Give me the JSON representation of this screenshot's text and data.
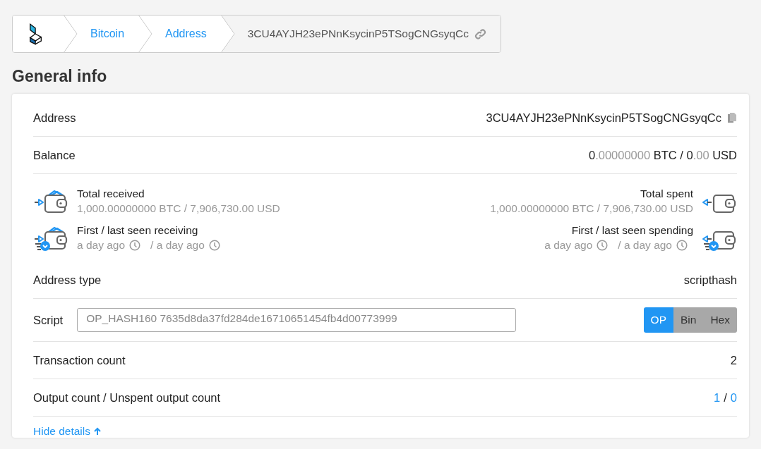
{
  "breadcrumb": {
    "items": [
      {
        "label": "Bitcoin",
        "kind": "link"
      },
      {
        "label": "Address",
        "kind": "link"
      },
      {
        "label": "3CU4AYJH23ePNnKsycinP5TSogCNGsyqCc",
        "kind": "current"
      }
    ]
  },
  "section_title": "General info",
  "address": {
    "label": "Address",
    "value": "3CU4AYJH23ePNnKsycinP5TSogCNGsyqCc"
  },
  "balance": {
    "label": "Balance",
    "parts": [
      {
        "text": "0",
        "muted": false
      },
      {
        "text": ".00000000",
        "muted": true
      },
      {
        "text": " BTC / 0",
        "muted": false
      },
      {
        "text": ".00",
        "muted": true
      },
      {
        "text": " USD",
        "muted": false
      }
    ]
  },
  "stats": {
    "received": [
      {
        "kind": "total",
        "title": "Total received",
        "value": "1,000.00000000 BTC / 7,906,730.00 USD"
      },
      {
        "kind": "seen",
        "title": "First / last seen receiving",
        "first": "a day ago",
        "last": "/ a day ago"
      }
    ],
    "spent": [
      {
        "kind": "total",
        "title": "Total spent",
        "value": "1,000.00000000 BTC / 7,906,730.00 USD"
      },
      {
        "kind": "seen",
        "title": "First / last seen spending",
        "first": "a day ago",
        "last": "/ a day ago"
      }
    ]
  },
  "address_type": {
    "label": "Address type",
    "value": "scripthash"
  },
  "script": {
    "label": "Script",
    "value": "OP_HASH160 7635d8da37fd284de16710651454fb4d00773999",
    "formats": [
      {
        "label": "OP",
        "selected": true
      },
      {
        "label": "Bin",
        "selected": false
      },
      {
        "label": "Hex",
        "selected": false
      }
    ]
  },
  "transaction_count": {
    "label": "Transaction count",
    "value": "2"
  },
  "output_count": {
    "label": "Output count / Unspent output count",
    "output": "1",
    "separator": "/",
    "unspent": "0"
  },
  "toggle_link": "Hide details"
}
